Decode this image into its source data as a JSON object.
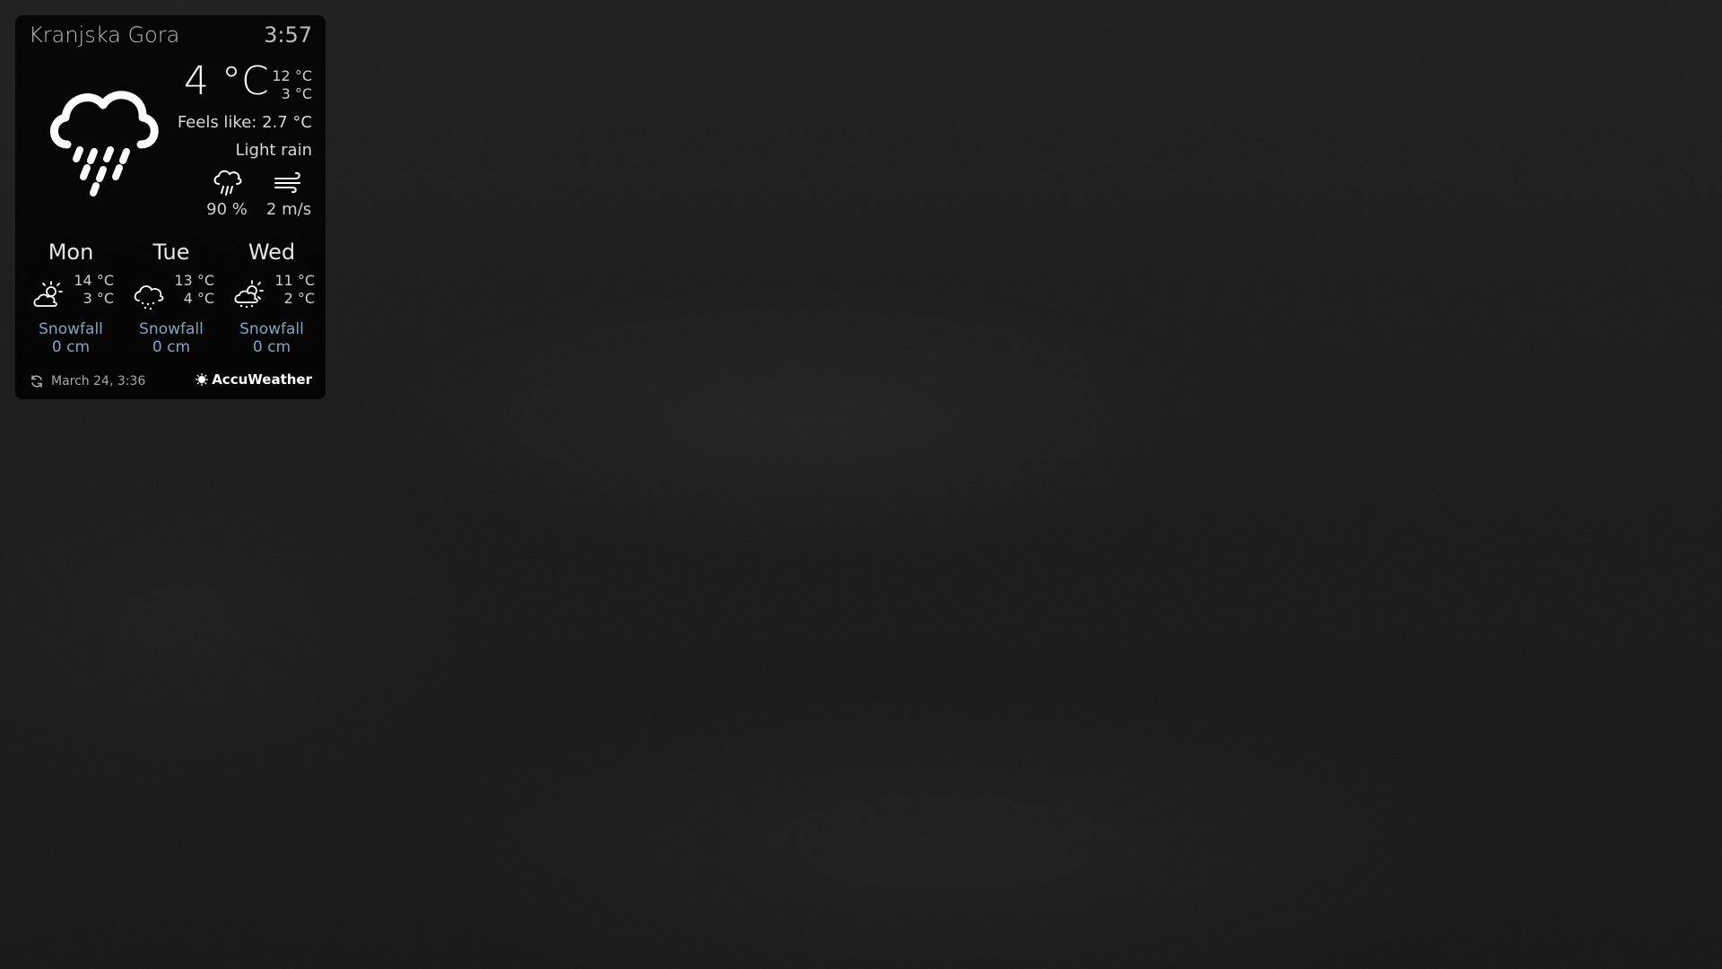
{
  "current": {
    "location": "Kranjska Gora",
    "time": "3:57",
    "temperature": "4 °C",
    "high": "12 °C",
    "low": "3 °C",
    "feels_like": "Feels like: 2.7 °C",
    "condition": "Light rain",
    "icon": "cloud-rain-icon",
    "precipitation": "90 %",
    "wind": "2 m/s"
  },
  "forecast": [
    {
      "day": "Mon",
      "high": "14 °C",
      "low": "3 °C",
      "icon": "partly-sunny-icon",
      "snow_label": "Snowfall",
      "snow_value": "0 cm"
    },
    {
      "day": "Tue",
      "high": "13 °C",
      "low": "4 °C",
      "icon": "cloud-drizzle-icon",
      "snow_label": "Snowfall",
      "snow_value": "0 cm"
    },
    {
      "day": "Wed",
      "high": "11 °C",
      "low": "2 °C",
      "icon": "sun-showers-icon",
      "snow_label": "Snowfall",
      "snow_value": "0 cm"
    }
  ],
  "footer": {
    "updated": "March 24, 3:36",
    "brand": "AccuWeather"
  },
  "colors": {
    "panel": "#000000",
    "snow_text": "#7fa6c4",
    "text": "#ffffff"
  }
}
